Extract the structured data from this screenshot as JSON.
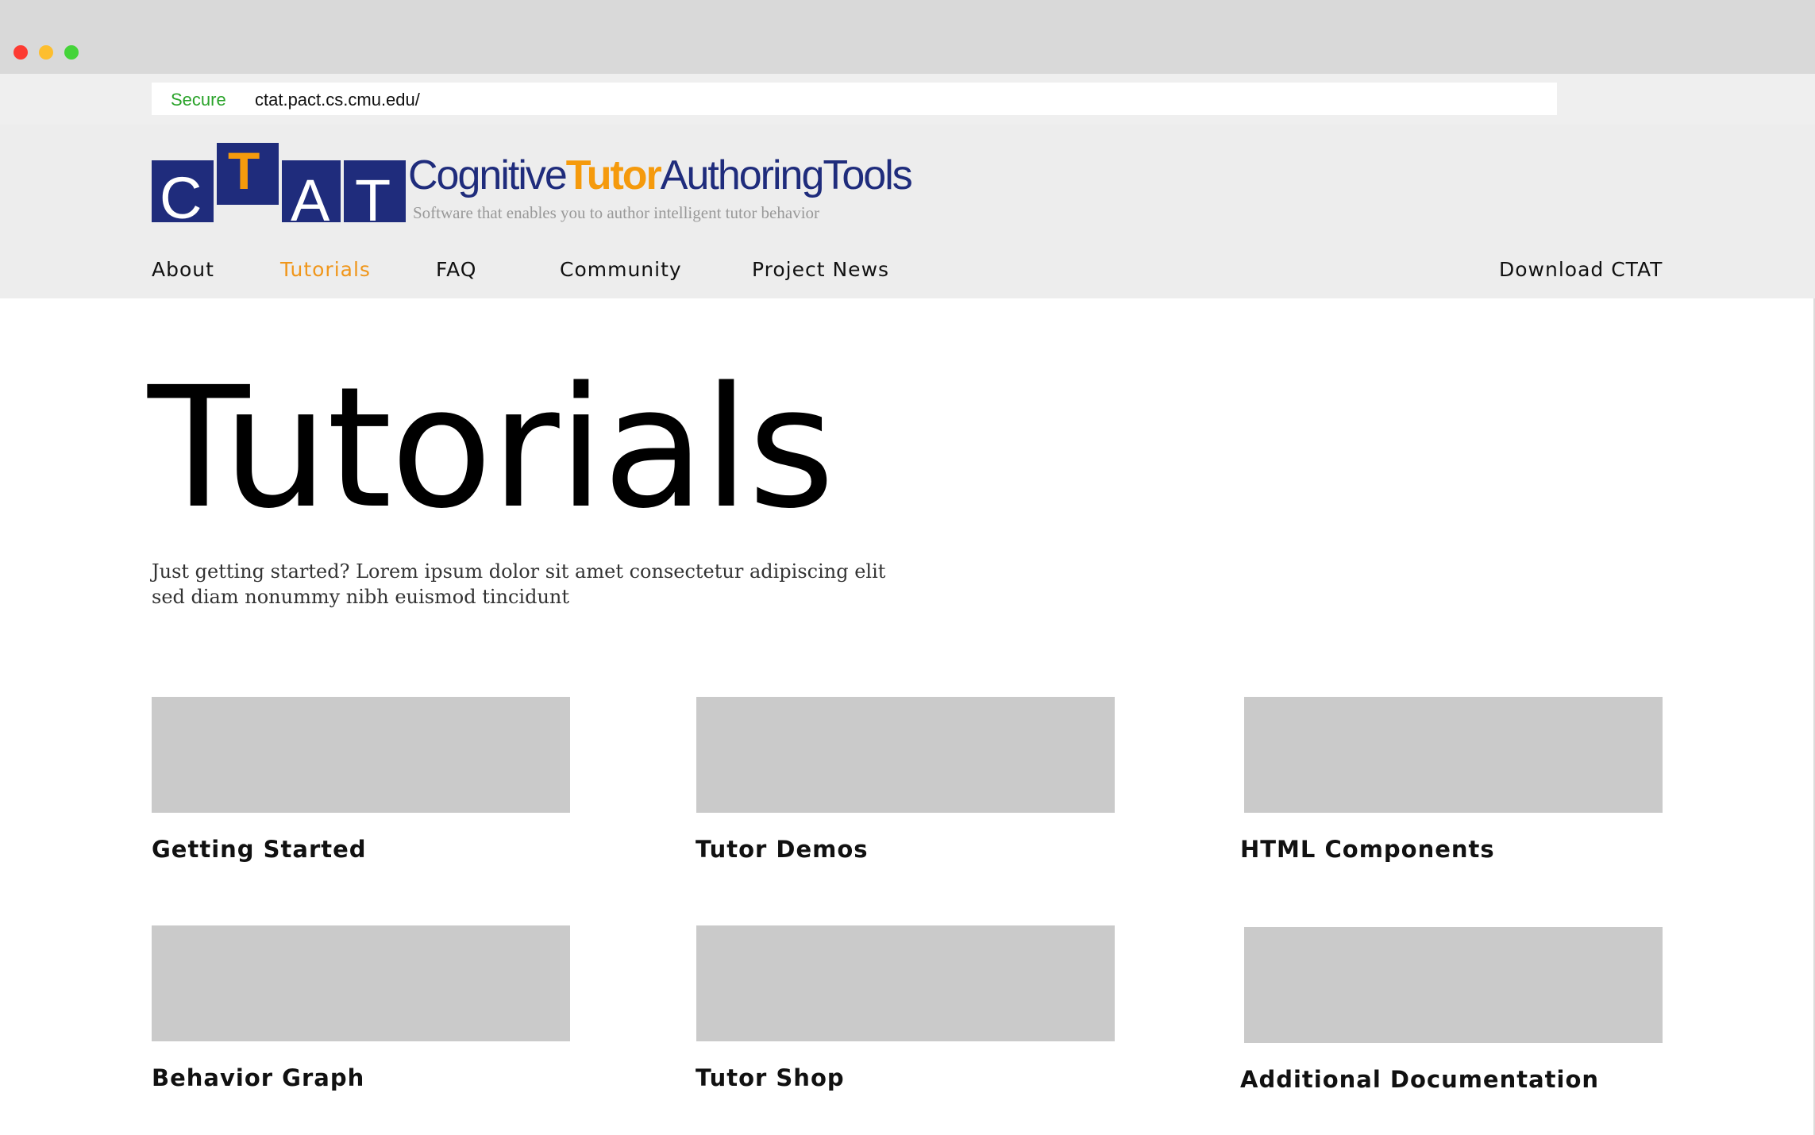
{
  "browser": {
    "secure_label": "Secure",
    "url": "ctat.pact.cs.cmu.edu/"
  },
  "logo": {
    "mark_letters": [
      "C",
      "T",
      "A",
      "T"
    ],
    "name_part1": "Cognitive",
    "name_part2": "Tutor",
    "name_part3": "AuthoringTools",
    "tagline": "Software that enables you to author intelligent tutor behavior",
    "colors": {
      "navy": "#1f2c7c",
      "orange": "#f59a0c"
    }
  },
  "nav": {
    "items": [
      {
        "label": "About"
      },
      {
        "label": "Tutorials",
        "active": true
      },
      {
        "label": "FAQ"
      },
      {
        "label": "Community"
      },
      {
        "label": "Project News"
      }
    ],
    "download_label": "Download CTAT",
    "active_color": "#f0961a"
  },
  "page": {
    "title": "Tutorials",
    "intro": "Just getting started? Lorem ipsum dolor sit amet consectetur adipiscing elit sed diam nonummy nibh euismod tincidunt"
  },
  "cards": [
    {
      "title": "Getting Started"
    },
    {
      "title": "Tutor Demos"
    },
    {
      "title": "HTML Components"
    },
    {
      "title": "Behavior Graph"
    },
    {
      "title": "Tutor Shop"
    },
    {
      "title": "Additional Documentation"
    }
  ]
}
